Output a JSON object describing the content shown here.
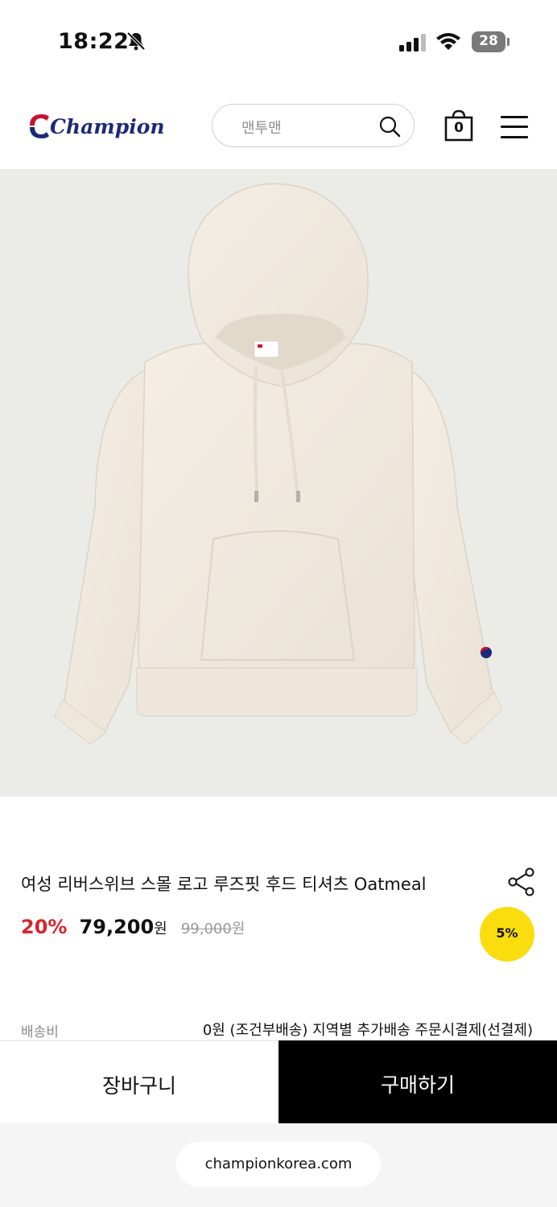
{
  "status_bar": {
    "time": "18:22",
    "battery": "28"
  },
  "header": {
    "logo_text": "Champion",
    "search_placeholder": "맨투맨",
    "cart_count": "0"
  },
  "product": {
    "title": "여성 리버스위브 스몰 로고 루즈핏 후드 티셔츠 Oatmeal",
    "discount": "20%",
    "price": "79,200",
    "price_unit": "원",
    "original_price": "99,000",
    "original_unit": "원",
    "badge": "5%"
  },
  "shipping": {
    "label": "배송비",
    "value": "0원 (조건부배송) 지역별 추가배송 주문시결제(선결제)"
  },
  "actions": {
    "cart_label": "장바구니",
    "buy_label": "구매하기"
  },
  "browser": {
    "url": "championkorea.com"
  },
  "colors": {
    "discount": "#d6262f",
    "badge": "#f9dd0f",
    "logo_blue": "#1d2a78",
    "logo_red": "#c8102e"
  }
}
